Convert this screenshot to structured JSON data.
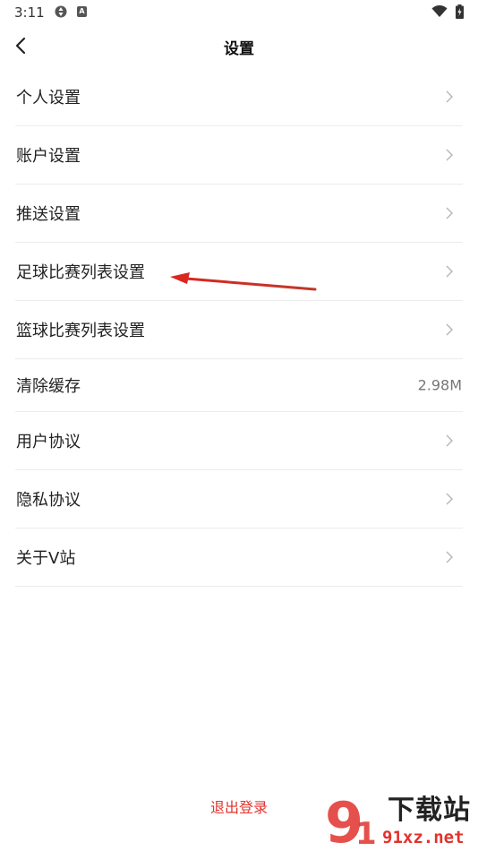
{
  "status_bar": {
    "time": "3:11",
    "notification_letter": "A"
  },
  "header": {
    "title": "设置"
  },
  "settings": {
    "items": [
      {
        "label": "个人设置",
        "type": "nav"
      },
      {
        "label": "账户设置",
        "type": "nav"
      },
      {
        "label": "推送设置",
        "type": "nav"
      },
      {
        "label": "足球比赛列表设置",
        "type": "nav"
      },
      {
        "label": "篮球比赛列表设置",
        "type": "nav"
      },
      {
        "label": "清除缓存",
        "type": "value",
        "value": "2.98M"
      },
      {
        "label": "用户协议",
        "type": "nav"
      },
      {
        "label": "隐私协议",
        "type": "nav"
      },
      {
        "label": "关于V站",
        "type": "nav"
      }
    ]
  },
  "footer": {
    "logout_label": "退出登录"
  },
  "watermark": {
    "logo_text": "9",
    "brand_text": "下载站",
    "url_text": "91xz.net"
  },
  "colors": {
    "accent": "#e2322d",
    "divider": "#ececec",
    "chevron": "#b5b5b5",
    "annotation_arrow": "#d9261f"
  },
  "icons": {
    "back": "chevron-left-icon",
    "row_arrow": "chevron-right-icon",
    "wifi": "wifi-icon",
    "battery": "battery-icon"
  }
}
